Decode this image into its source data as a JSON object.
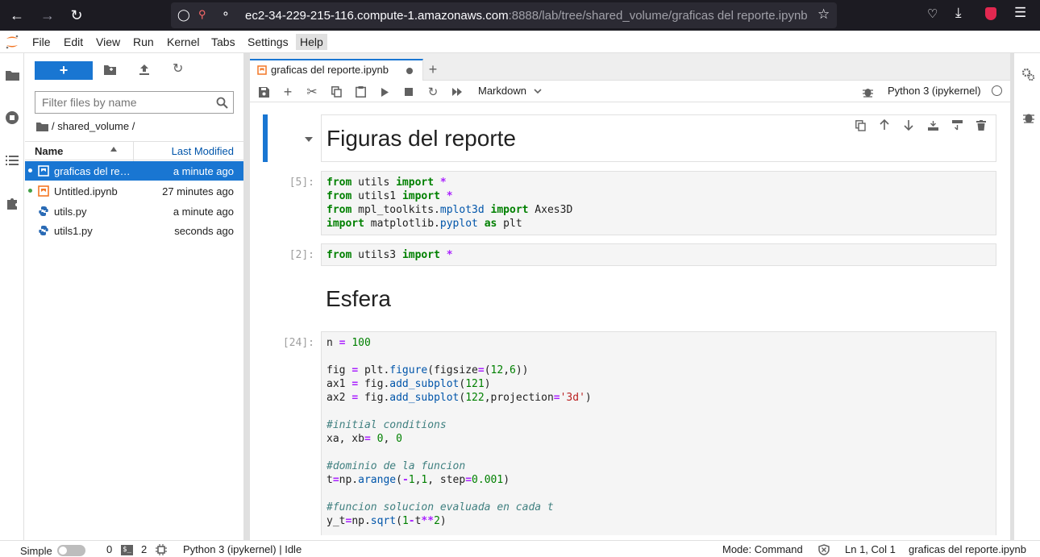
{
  "browser": {
    "url_host": "ec2-34-229-215-116.compute-1.amazonaws.com",
    "url_path": ":8888/lab/tree/shared_volume/graficas del reporte.ipynb"
  },
  "menu": [
    "File",
    "Edit",
    "View",
    "Run",
    "Kernel",
    "Tabs",
    "Settings",
    "Help"
  ],
  "filebrowser": {
    "new_label": "+",
    "search_placeholder": "Filter files by name",
    "breadcrumb": "/ shared_volume /",
    "col_name": "Name",
    "col_modified": "Last Modified",
    "files": [
      {
        "name": "graficas del reporte.ipynb",
        "modified": "a minute ago",
        "type": "notebook",
        "running": true,
        "selected": true
      },
      {
        "name": "Untitled.ipynb",
        "modified": "27 minutes ago",
        "type": "notebook",
        "running": true,
        "selected": false
      },
      {
        "name": "utils.py",
        "modified": "a minute ago",
        "type": "python",
        "running": false,
        "selected": false
      },
      {
        "name": "utils1.py",
        "modified": "seconds ago",
        "type": "python",
        "running": false,
        "selected": false
      }
    ]
  },
  "tabs": [
    {
      "label": "graficas del reporte.ipynb",
      "dirty": true
    }
  ],
  "toolbar": {
    "cell_type": "Markdown",
    "kernel": "Python 3 (ipykernel)"
  },
  "cells": {
    "heading1": "Figuras del reporte",
    "prompt1": "[5]:",
    "prompt2": "[2]:",
    "heading2": "Esfera",
    "prompt3": "[24]:"
  },
  "status": {
    "mode_label": "Simple",
    "terminals": "0",
    "kernels": "2",
    "kernel_state": "Python 3 (ipykernel) | Idle",
    "mode": "Mode: Command",
    "position": "Ln 1, Col 1",
    "filename": "graficas del reporte.ipynb"
  },
  "colors": {
    "accent": "#1976d2",
    "jupyter_orange": "#f37726"
  }
}
